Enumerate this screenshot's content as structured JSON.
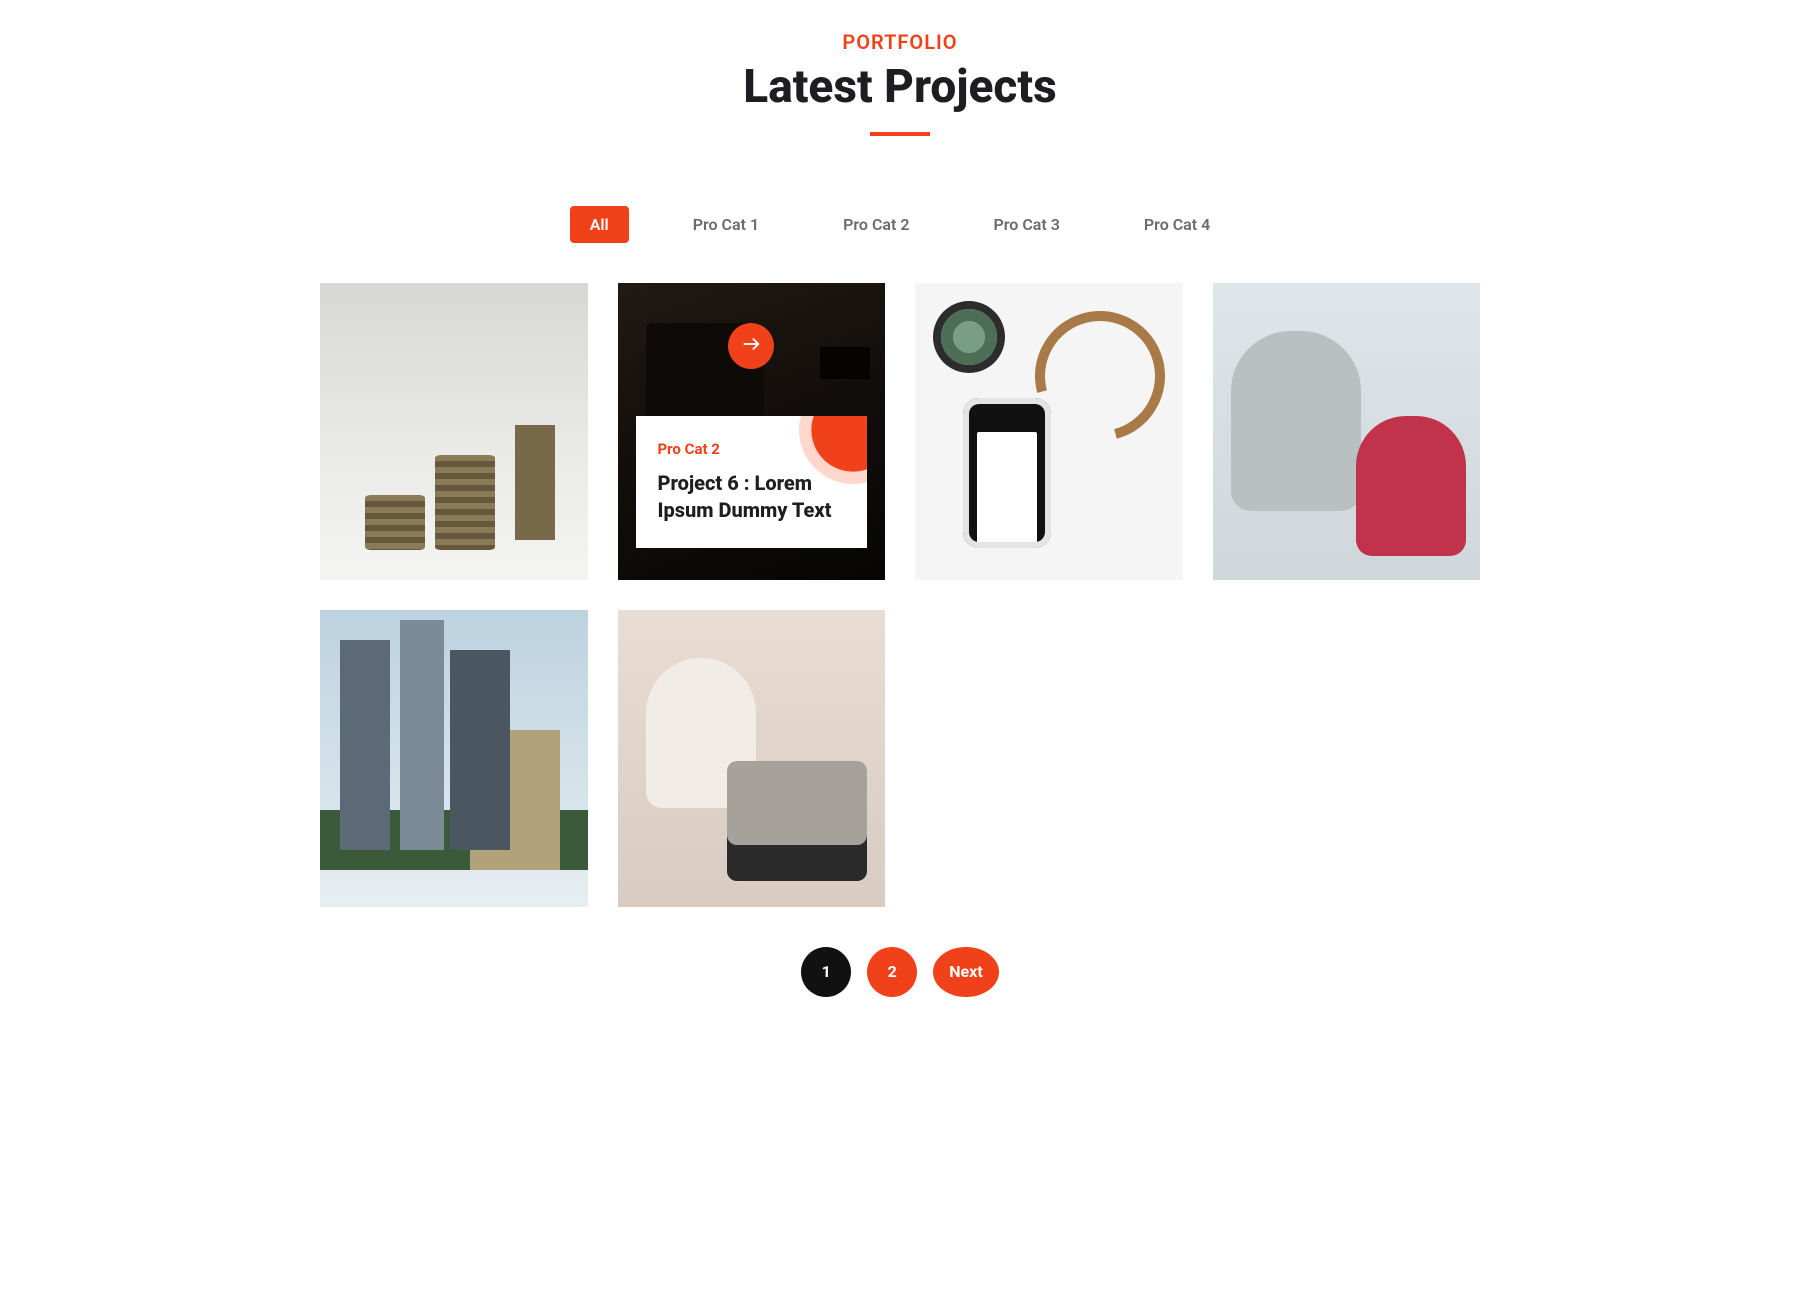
{
  "header": {
    "eyebrow": "PORTFOLIO",
    "title": "Latest Projects"
  },
  "filters": {
    "items": [
      {
        "label": "All",
        "active": true
      },
      {
        "label": "Pro Cat 1",
        "active": false
      },
      {
        "label": "Pro Cat 2",
        "active": false
      },
      {
        "label": "Pro Cat 3",
        "active": false
      },
      {
        "label": "Pro Cat 4",
        "active": false
      }
    ]
  },
  "grid": {
    "active_card": {
      "category": "Pro Cat 2",
      "title": "Project 6 : Lorem Ipsum Dummy Text"
    }
  },
  "pagination": {
    "page_1": "1",
    "page_2": "2",
    "next": "Next"
  },
  "colors": {
    "accent": "#f0411a",
    "text": "#1e1e22",
    "muted": "#6b6b6b"
  }
}
